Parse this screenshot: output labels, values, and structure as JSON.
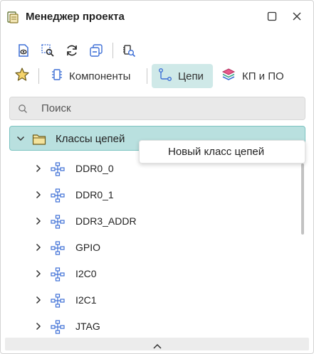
{
  "window": {
    "title": "Менеджер проекта",
    "icon": "project-manager-icon",
    "buttons": [
      "maximize-icon",
      "close-icon"
    ]
  },
  "toolbar": {
    "icons": [
      "document-view-icon",
      "zoom-select-icon",
      "refresh-icon",
      "collapse-icon",
      "find-component-icon"
    ]
  },
  "tabs": {
    "favorites_icon": "star-icon",
    "components_label": "Компоненты",
    "nets_label": "Цепи",
    "pcb_label": "КП и ПО",
    "active": "nets"
  },
  "search": {
    "placeholder": "Поиск",
    "value": ""
  },
  "tree": {
    "root": {
      "label": "Классы цепей",
      "expanded": true
    },
    "items": [
      {
        "label": "DDR0_0"
      },
      {
        "label": "DDR0_1"
      },
      {
        "label": "DDR3_ADDR"
      },
      {
        "label": "GPIO"
      },
      {
        "label": "I2C0"
      },
      {
        "label": "I2C1"
      },
      {
        "label": "JTAG"
      }
    ]
  },
  "context_menu": {
    "items": [
      {
        "label": "Новый класс цепей"
      }
    ]
  },
  "colors": {
    "accent": "#cfe9e8",
    "selection": "#b9e0df",
    "selection_border": "#7cc3c1",
    "icon_blue": "#3d6fd6",
    "star": "#e3b33a"
  }
}
